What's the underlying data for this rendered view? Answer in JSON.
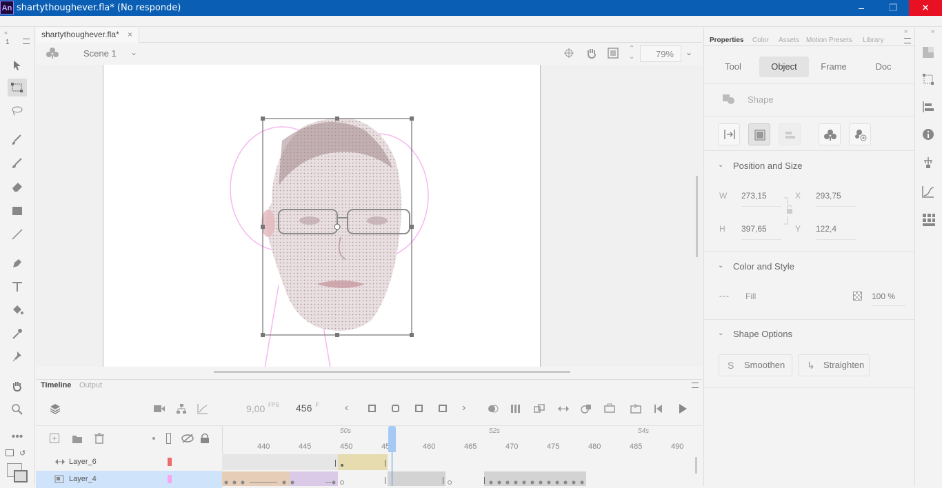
{
  "window": {
    "app_logo": "An",
    "title": "shartythoughever.fla* (No responde)"
  },
  "document": {
    "tab_label": "shartythoughever.fla*",
    "scene_label": "Scene 1",
    "zoom": "79%"
  },
  "toolbar": {
    "indicator": "1",
    "tools": [
      "selection-icon",
      "free-transform-icon",
      "lasso-icon",
      "paint-brush-icon",
      "brush-icon",
      "eraser-icon",
      "rectangle-icon",
      "line-icon",
      "pen-icon",
      "text-icon",
      "paint-bucket-icon",
      "eyedropper-icon",
      "pin-icon",
      "hand-icon",
      "zoom-icon",
      "more-icon"
    ],
    "active_tool": "free-transform-icon"
  },
  "timeline": {
    "tabs": {
      "timeline": "Timeline",
      "output": "Output"
    },
    "fps": "9,00",
    "fps_unit": "FPS",
    "frame": "456",
    "frame_unit": "F",
    "ruler_ticks": [
      "440",
      "445",
      "450",
      "455",
      "460",
      "465",
      "470",
      "475",
      "480",
      "485",
      "490"
    ],
    "ruler_seconds": [
      "50s",
      "52s",
      "54s"
    ],
    "layers": [
      {
        "name": "Layer_6",
        "color": "#ee6b6b"
      },
      {
        "name": "Layer_4",
        "color": "#f7a6ef"
      }
    ]
  },
  "properties": {
    "tabs": [
      "Properties",
      "Color",
      "Assets",
      "Motion Presets",
      "Library"
    ],
    "subtabs": [
      "Tool",
      "Object",
      "Frame",
      "Doc"
    ],
    "active_subtab": "Object",
    "object_type": "Shape",
    "position_size": {
      "title": "Position and Size",
      "w_label": "W",
      "w_value": "273,15",
      "h_label": "H",
      "h_value": "397,65",
      "x_label": "X",
      "x_value": "293,75",
      "y_label": "Y",
      "y_value": "122,4"
    },
    "color_style": {
      "title": "Color and Style",
      "fill_label": "Fill",
      "fill_swatch": "---",
      "alpha": "100 %"
    },
    "shape_options": {
      "title": "Shape Options",
      "smoothen": "Smoothen",
      "straighten": "Straighten"
    }
  },
  "colors": {
    "titlebar": "#0a5fb4",
    "close": "#e81123",
    "playhead": "#a5c9f5",
    "selection_row": "#cfe3fa"
  }
}
